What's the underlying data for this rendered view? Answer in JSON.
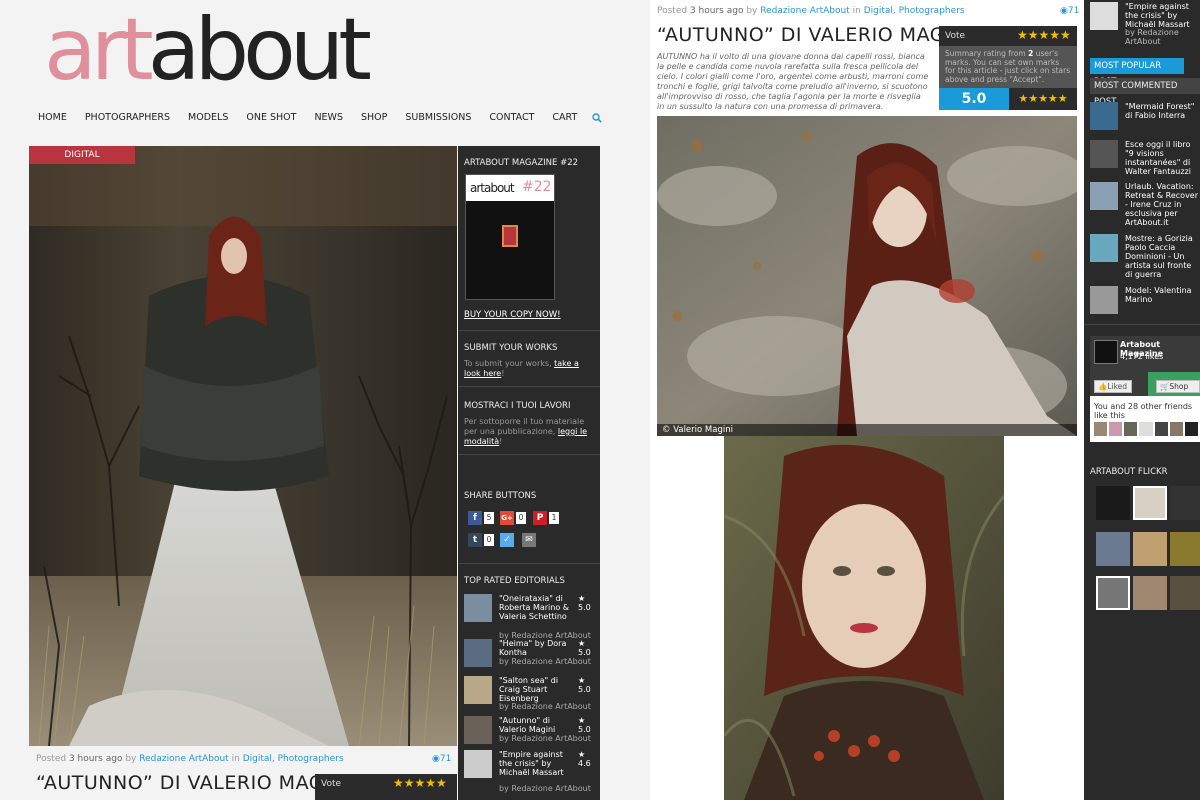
{
  "logo": {
    "part1": "art",
    "part2": "about"
  },
  "nav": {
    "items": [
      "HOME",
      "PHOTOGRAPHERS",
      "MODELS",
      "ONE SHOT",
      "NEWS",
      "SHOP",
      "SUBMISSIONS",
      "CONTACT",
      "CART"
    ]
  },
  "post": {
    "category": "DIGITAL",
    "posted_prefix": "Posted",
    "time": "3 hours ago",
    "by": "by",
    "author": "Redazione ArtAbout",
    "in": "in",
    "categories": "Digital, Photographers",
    "views": "71",
    "title": "“AUTUNNO” DI VALERIO MAGINI",
    "excerpt": "AUTUNNO ha il volto di una giovane donna dai capelli rossi, bianca la pelle e candida come nuvola rarefatta sulla fresca pellicola del cielo. I colori gialli come l'oro, argentei come arbusti, marroni come tronchi e foglie, grigi talvolta come preludio all'inverno, si scuotono all'improvviso di rosso, che taglia l'agonia per la morte e risveglia in un sussulto la natura con una promessa di primavera.",
    "photo_credit": "© Valerio Magini"
  },
  "vote": {
    "label": "Vote",
    "stars": "★★★★★",
    "summary_pre": "Summary rating from",
    "summary_count": "2",
    "summary_post": "user's marks. You can set own marks for this article - just click on stars above and press \"Accept\".",
    "score": "5.0"
  },
  "sidebar": {
    "magazine_title": "ARTABOUT MAGAZINE #22",
    "magazine_cover_brand": "artabout",
    "magazine_cover_issue": "#22",
    "buy_link": "BUY YOUR COPY NOW!",
    "submit_title": "SUBMIT YOUR WORKS",
    "submit_text": "To submit your works,",
    "submit_link": "take a look here",
    "show_title": "MOSTRACI I TUOI LAVORI",
    "show_text": "Per sottoporre il tuo materiale per una pubblicazione,",
    "show_link": "leggi le modalità",
    "share_title": "SHARE BUTTONS",
    "share": [
      {
        "icon": "f",
        "count": "5",
        "color": "#3b5998"
      },
      {
        "icon": "G+",
        "count": "0",
        "color": "#dd4b39"
      },
      {
        "icon": "P",
        "count": "1",
        "color": "#cb2027"
      },
      {
        "icon": "t",
        "count": "0",
        "color": "#35465c"
      },
      {
        "icon": "✓",
        "count": "",
        "color": "#55acee"
      },
      {
        "icon": "✉",
        "count": "",
        "color": "#777777"
      }
    ],
    "top_rated_title": "TOP RATED EDITORIALS",
    "top_rated": [
      {
        "title": "\"Oneirataxia\" di Roberta Marino & Valeria Schettino",
        "by": "by Redazione ArtAbout",
        "score": "★ 5.0"
      },
      {
        "title": "\"Heima\" by Dora Kontha",
        "by": "by Redazione ArtAbout",
        "score": "★ 5.0"
      },
      {
        "title": "\"Salton sea\" di Craig Stuart Eisenberg",
        "by": "by Redazione ArtAbout",
        "score": "★ 5.0"
      },
      {
        "title": "\"Autunno\" di Valerio Magini",
        "by": "by Redazione ArtAbout",
        "score": "★ 5.0"
      },
      {
        "title": "\"Empire against the crisis\" by Michaël Massart",
        "by": "by Redazione ArtAbout",
        "score": "★ 4.6"
      }
    ]
  },
  "right_sidebar": {
    "top_item": {
      "title": "\"Empire against the crisis\" by Michaël Massart",
      "by": "by Redazione ArtAbout"
    },
    "tab_popular": "MOST POPULAR POST",
    "tab_commented": "MOST COMMENTED POST",
    "commented": [
      {
        "title": "\"Mermaid Forest\" di Fabio Interra"
      },
      {
        "title": "Esce oggi il libro \"9 visions instantanées\" di Walter Fantauzzi"
      },
      {
        "title": "Urlaub. Vacation: Retreat & Recover - Irene Cruz in esclusiva per ArtAbout.it"
      },
      {
        "title": "Mostre: a Gorizia Paolo Caccia Dominioni - Un artista sul fronte di guerra"
      },
      {
        "title": "Model: Valentina Marino"
      }
    ],
    "fb_page": "Artabout Magazine",
    "fb_likes": "4,172 likes",
    "fb_liked": "Liked",
    "fb_shop": "Shop",
    "fb_friends": "You and 28 other friends like this",
    "flickr_title": "ARTABOUT FLICKR"
  },
  "colors": {
    "accent_blue": "#1a9ad8",
    "category_red": "#b8343f",
    "logo_pink": "#e0909c",
    "star_gold": "#f0c000"
  }
}
